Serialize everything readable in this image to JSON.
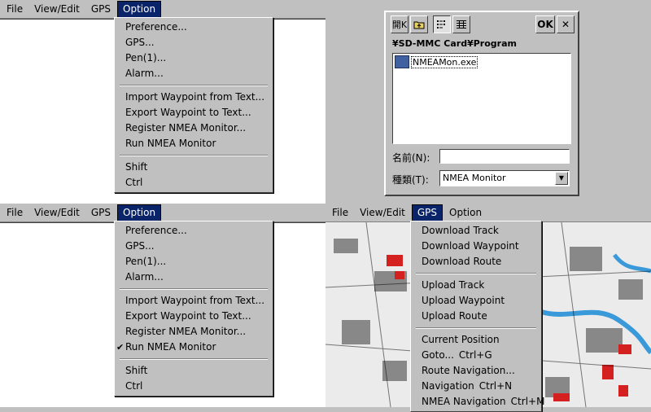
{
  "menubar_top_left": {
    "items": [
      "File",
      "View/Edit",
      "GPS",
      "Option"
    ],
    "active": "Option"
  },
  "option_menu": {
    "groups": [
      [
        "Preference...",
        "GPS...",
        "Pen(1)...",
        "Alarm..."
      ],
      [
        "Import Waypoint from Text...",
        "Export Waypoint to Text...",
        "Register NMEA Monitor...",
        "Run NMEA Monitor"
      ],
      [
        "Shift",
        "Ctrl"
      ]
    ]
  },
  "menubar_bottom_left": {
    "items": [
      "File",
      "View/Edit",
      "GPS",
      "Option"
    ],
    "active": "Option"
  },
  "option_menu_checked": {
    "groups": [
      [
        "Preference...",
        "GPS...",
        "Pen(1)...",
        "Alarm..."
      ],
      [
        "Import Waypoint from Text...",
        "Export Waypoint to Text...",
        "Register NMEA Monitor...",
        "Run NMEA Monitor"
      ],
      [
        "Shift",
        "Ctrl"
      ]
    ],
    "checked_item": "Run NMEA Monitor"
  },
  "menubar_bottom_right": {
    "items": [
      "File",
      "View/Edit",
      "GPS",
      "Option"
    ],
    "active": "GPS"
  },
  "gps_menu": {
    "groups": [
      [
        {
          "label": "Download Track"
        },
        {
          "label": "Download Waypoint"
        },
        {
          "label": "Download Route"
        }
      ],
      [
        {
          "label": "Upload Track"
        },
        {
          "label": "Upload Waypoint"
        },
        {
          "label": "Upload Route"
        }
      ],
      [
        {
          "label": "Current Position"
        },
        {
          "label": "Goto...",
          "shortcut": "Ctrl+G"
        },
        {
          "label": "Route Navigation..."
        },
        {
          "label": "Navigation",
          "shortcut": "Ctrl+N"
        },
        {
          "label": "NMEA Navigation",
          "shortcut": "Ctrl+M"
        }
      ]
    ]
  },
  "open_dialog": {
    "open_button": "開K",
    "ok_button": "OK",
    "close_button": "✕",
    "path": "¥SD-MMC Card¥Program",
    "file": "NMEAMon.exe",
    "name_label": "名前(N):",
    "name_value": "",
    "type_label": "種類(T):",
    "type_value": "NMEA Monitor"
  },
  "icons": {
    "up-folder": "up-folder-icon",
    "list-view": "list-view-icon",
    "detail-view": "detail-view-icon",
    "dropdown": "chevron-down-icon"
  },
  "colors": {
    "menu_bg": "#c0c0c0",
    "highlight": "#0a246a",
    "canvas": "#ffffff"
  }
}
